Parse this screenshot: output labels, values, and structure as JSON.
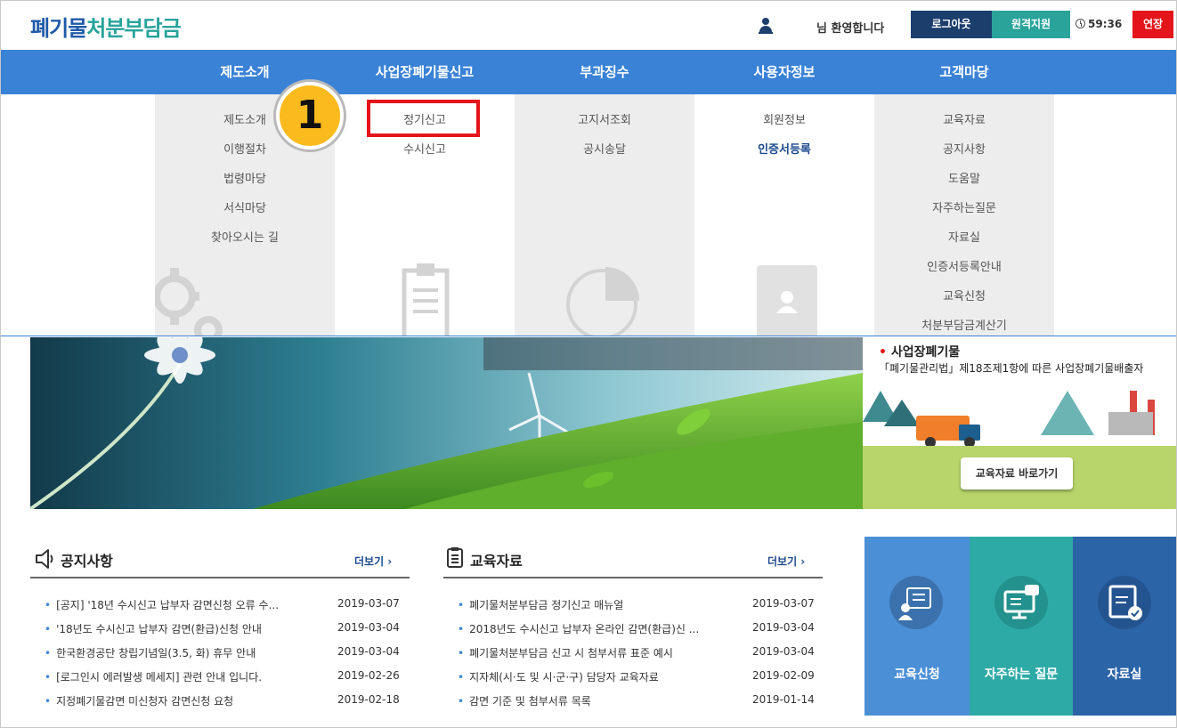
{
  "header": {
    "logo_part1": "폐기물",
    "logo_part2": "처분부담금",
    "welcome": "님 환영합니다",
    "logout": "로그아웃",
    "remote_support": "원격지원",
    "timer": "59:36",
    "extend": "연장"
  },
  "nav": {
    "items": [
      {
        "label": "제도소개",
        "sub": [
          "제도소개",
          "이행절차",
          "법령마당",
          "서식마당",
          "찾아오시는 길"
        ]
      },
      {
        "label": "사업장폐기물신고",
        "sub": [
          "정기신고",
          "수시신고"
        ]
      },
      {
        "label": "부과징수",
        "sub": [
          "고지서조회",
          "공시송달"
        ]
      },
      {
        "label": "사용자정보",
        "sub": [
          "회원정보",
          "인증서등록"
        ]
      },
      {
        "label": "고객마당",
        "sub": [
          "교육자료",
          "공지사항",
          "도움말",
          "자주하는질문",
          "자료실",
          "인증서등록안내",
          "교육신청",
          "처분부담금계산기"
        ]
      }
    ]
  },
  "callout": {
    "number": "1"
  },
  "banner": {
    "side_title": "사업장폐기물",
    "side_desc": "「폐기물관리법」제18조제1항에 따른 사업장폐기물배출자",
    "side_button": "교육자료 바로가기"
  },
  "notice": {
    "title": "공지사항",
    "more": "더보기 ›",
    "items": [
      {
        "title": "[공지] '18년 수시신고 납부자 감면신청 오류 수...",
        "date": "2019-03-07"
      },
      {
        "title": "'18년도 수시신고 납부자 감면(환급)신청 안내",
        "date": "2019-03-04"
      },
      {
        "title": "한국환경공단 창립기념일(3.5, 화) 휴무 안내",
        "date": "2019-03-04"
      },
      {
        "title": "[로그인시 에러발생 메세지] 관련 안내 입니다.",
        "date": "2019-02-26"
      },
      {
        "title": "지정폐기물감면 미신청자 감면신청 요청",
        "date": "2019-02-18"
      }
    ]
  },
  "edu": {
    "title": "교육자료",
    "more": "더보기 ›",
    "items": [
      {
        "title": "폐기물처분부담금 정기신고 매뉴얼",
        "date": "2019-03-07"
      },
      {
        "title": "2018년도 수시신고 납부자 온라인 감면(환급)신 ...",
        "date": "2019-03-04"
      },
      {
        "title": "폐기물처분부담금 신고 시 첨부서류 표준 예시",
        "date": "2019-03-04"
      },
      {
        "title": "지자체(시·도 및 시·군·구) 담당자 교육자료",
        "date": "2019-02-09"
      },
      {
        "title": "감면 기준 및 첨부서류 목록",
        "date": "2019-01-14"
      }
    ]
  },
  "quick": [
    {
      "label": "교육신청",
      "color": "#4b8fd6"
    },
    {
      "label": "자주하는 질문",
      "color": "#2eaaa6"
    },
    {
      "label": "자료실",
      "color": "#2c64a8"
    }
  ],
  "colors": {
    "nav": "#3a82d6",
    "brand_blue": "#1f5aa8",
    "brand_green": "#27a39b",
    "highlight": "#e3151b",
    "badge": "#fbba1e"
  }
}
